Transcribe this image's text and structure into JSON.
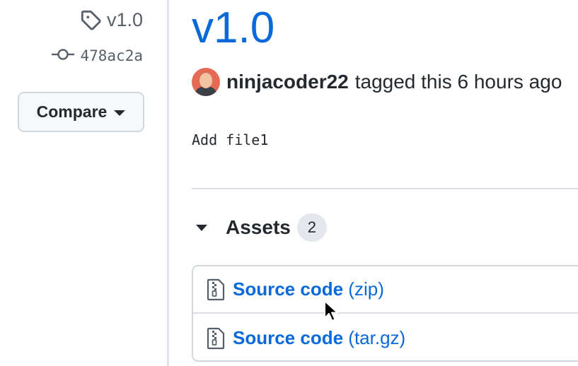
{
  "sidebar": {
    "tag": {
      "icon": "tag-icon",
      "label": "v1.0"
    },
    "commit": {
      "icon": "git-commit-icon",
      "sha": "478ac2a"
    },
    "compare_button": {
      "label": "Compare",
      "icon": "triangle-down-icon"
    }
  },
  "release": {
    "title": "v1.0",
    "author": "ninjacoder22",
    "byline_rest": "tagged this 6 hours ago",
    "commit_message": "Add file1"
  },
  "assets": {
    "title": "Assets",
    "count": "2",
    "items": [
      {
        "icon": "file-zip-icon",
        "name": "Source code",
        "ext": "(zip)"
      },
      {
        "icon": "file-zip-icon",
        "name": "Source code",
        "ext": "(tar.gz)"
      }
    ]
  },
  "colors": {
    "link": "#0969da",
    "text": "#24292f",
    "muted": "#57606a",
    "border": "#d0d7de"
  }
}
